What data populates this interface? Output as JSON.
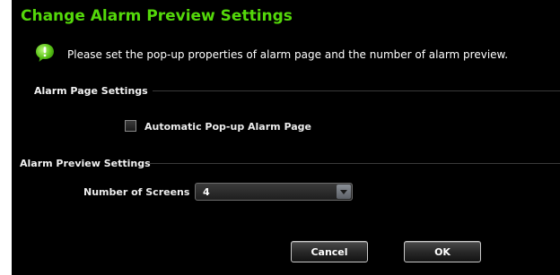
{
  "dialog": {
    "title": "Change Alarm Preview Settings",
    "info_text": "Please set the pop-up properties of alarm page and the number of alarm preview.",
    "info_icon": "info-bubble-icon",
    "accent_color": "#54d80a"
  },
  "alarm_page": {
    "section_label": "Alarm Page Settings",
    "auto_popup_label": "Automatic Pop-up Alarm Page",
    "auto_popup_checked": false
  },
  "alarm_preview": {
    "section_label": "Alarm Preview Settings",
    "screens_label": "Number of Screens",
    "screens_value": "4"
  },
  "buttons": {
    "cancel_label": "Cancel",
    "ok_label": "OK"
  }
}
